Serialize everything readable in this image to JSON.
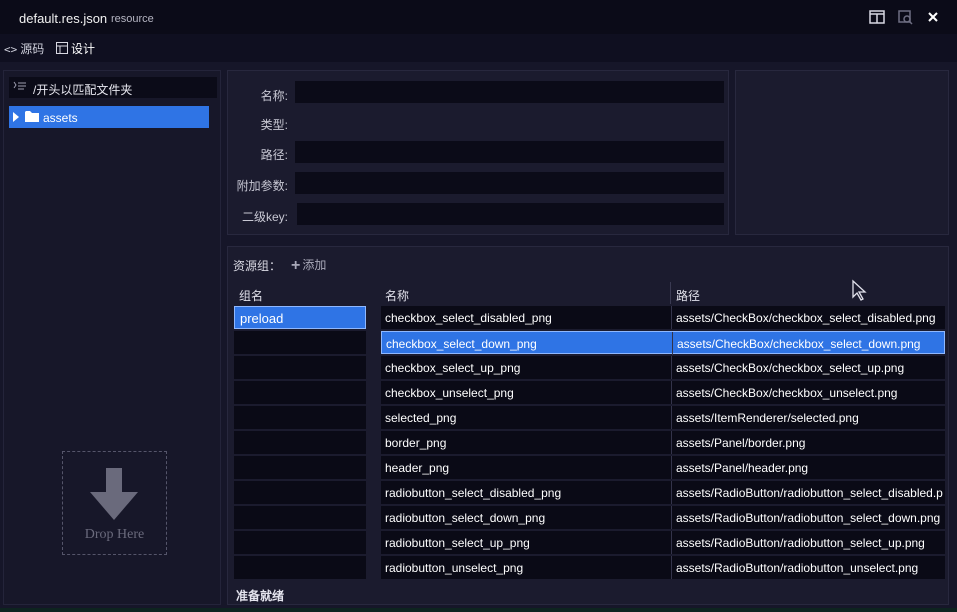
{
  "window": {
    "title": "default.res.json",
    "subtitle": "resource",
    "controls": {
      "split": "split-view-icon",
      "pin": "pin-icon",
      "close": "close-icon"
    }
  },
  "modes": {
    "source_label": "源码",
    "design_label": "设计",
    "active": "design"
  },
  "tree": {
    "filter_text": "/开头以匹配文件夹",
    "items": [
      {
        "label": "assets",
        "selected": true
      }
    ],
    "drop_text": "Drop Here"
  },
  "properties": {
    "name_label": "名称:",
    "type_label": "类型:",
    "path_label": "路径:",
    "params_label": "附加参数:",
    "subkey_label": "二级key:"
  },
  "groups": {
    "title": "资源组：",
    "add_label": "添加",
    "group_header": "组名",
    "name_header": "名称",
    "path_header": "路径",
    "list": [
      {
        "name": "preload",
        "selected": true
      }
    ],
    "resources": [
      {
        "name": "checkbox_select_disabled_png",
        "path": "assets/CheckBox/checkbox_select_disabled.png"
      },
      {
        "name": "checkbox_select_down_png",
        "path": "assets/CheckBox/checkbox_select_down.png",
        "selected": true
      },
      {
        "name": "checkbox_select_up_png",
        "path": "assets/CheckBox/checkbox_select_up.png"
      },
      {
        "name": "checkbox_unselect_png",
        "path": "assets/CheckBox/checkbox_unselect.png"
      },
      {
        "name": "selected_png",
        "path": "assets/ItemRenderer/selected.png"
      },
      {
        "name": "border_png",
        "path": "assets/Panel/border.png"
      },
      {
        "name": "header_png",
        "path": "assets/Panel/header.png"
      },
      {
        "name": "radiobutton_select_disabled_png",
        "path": "assets/RadioButton/radiobutton_select_disabled.p"
      },
      {
        "name": "radiobutton_select_down_png",
        "path": "assets/RadioButton/radiobutton_select_down.png"
      },
      {
        "name": "radiobutton_select_up_png",
        "path": "assets/RadioButton/radiobutton_select_up.png"
      },
      {
        "name": "radiobutton_unselect_png",
        "path": "assets/RadioButton/radiobutton_unselect.png"
      }
    ]
  },
  "status": "准备就绪",
  "colors": {
    "accent": "#2f74e5",
    "background": "#161629",
    "panel": "#1b1b2e",
    "input": "#0b0b18"
  }
}
